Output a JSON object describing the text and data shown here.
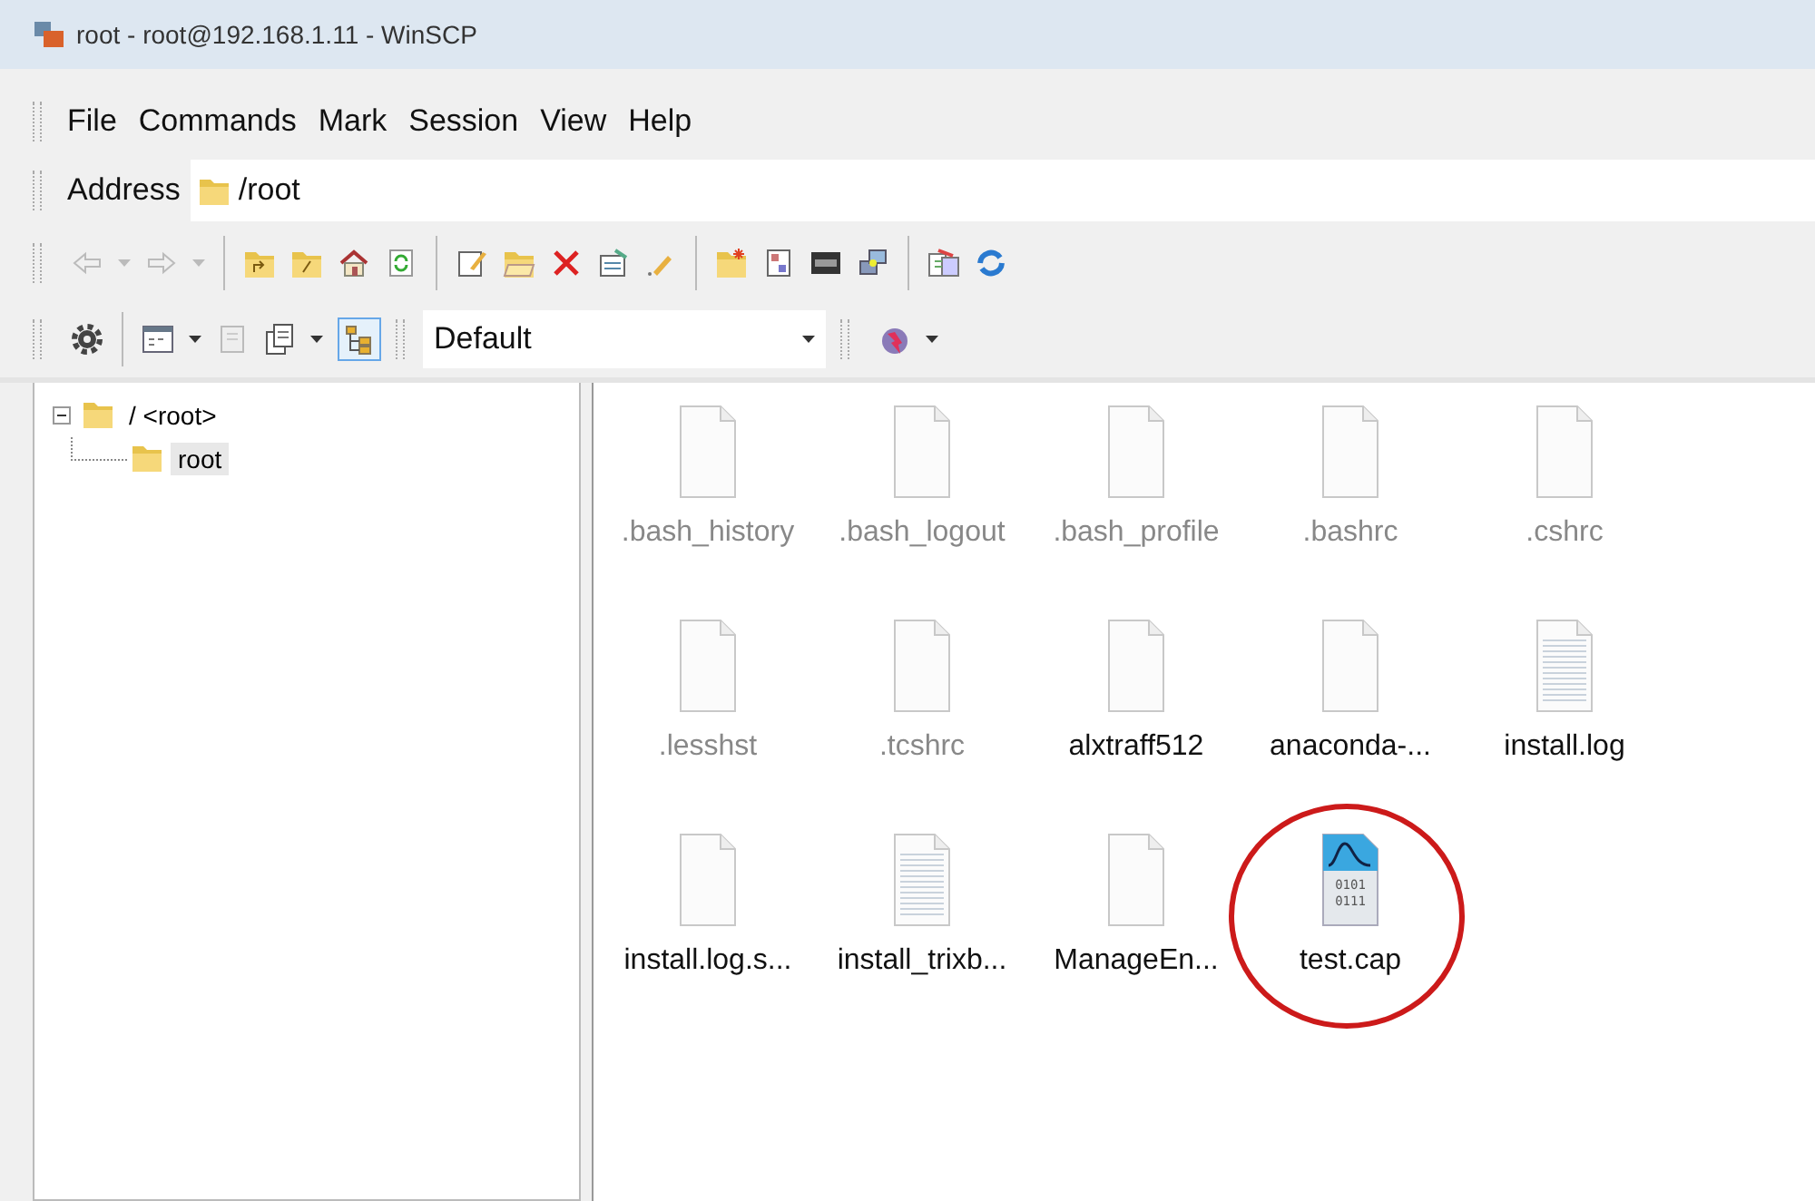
{
  "window": {
    "title": "root - root@192.168.1.11 - WinSCP"
  },
  "menu": [
    "File",
    "Commands",
    "Mark",
    "Session",
    "View",
    "Help"
  ],
  "address": {
    "label": "Address",
    "value": "/root"
  },
  "toolbar": {
    "layout_select": "Default",
    "tree_toggle_on": true
  },
  "tree": [
    {
      "label": "/ <root>",
      "expanded": true,
      "selected": false,
      "children": [
        {
          "label": "root",
          "selected": true
        }
      ]
    }
  ],
  "files": [
    {
      "name": ".bash_history",
      "kind": "blank",
      "hidden": true,
      "circled": false
    },
    {
      "name": ".bash_logout",
      "kind": "blank",
      "hidden": true,
      "circled": false
    },
    {
      "name": ".bash_profile",
      "kind": "blank",
      "hidden": true,
      "circled": false
    },
    {
      "name": ".bashrc",
      "kind": "blank",
      "hidden": true,
      "circled": false
    },
    {
      "name": ".cshrc",
      "kind": "blank",
      "hidden": true,
      "circled": false
    },
    {
      "name": ".lesshst",
      "kind": "blank",
      "hidden": true,
      "circled": false
    },
    {
      "name": ".tcshrc",
      "kind": "blank",
      "hidden": true,
      "circled": false
    },
    {
      "name": "alxtraff512",
      "kind": "blank",
      "hidden": false,
      "circled": false
    },
    {
      "name": "anaconda-...",
      "kind": "blank",
      "hidden": false,
      "circled": false
    },
    {
      "name": "install.log",
      "kind": "text",
      "hidden": false,
      "circled": false
    },
    {
      "name": "install.log.s...",
      "kind": "blank",
      "hidden": false,
      "circled": false
    },
    {
      "name": "install_trixb...",
      "kind": "text",
      "hidden": false,
      "circled": false
    },
    {
      "name": "ManageEn...",
      "kind": "blank",
      "hidden": false,
      "circled": false
    },
    {
      "name": "test.cap",
      "kind": "capture",
      "hidden": false,
      "circled": true,
      "icon_text": [
        "0101",
        "0111"
      ]
    }
  ]
}
